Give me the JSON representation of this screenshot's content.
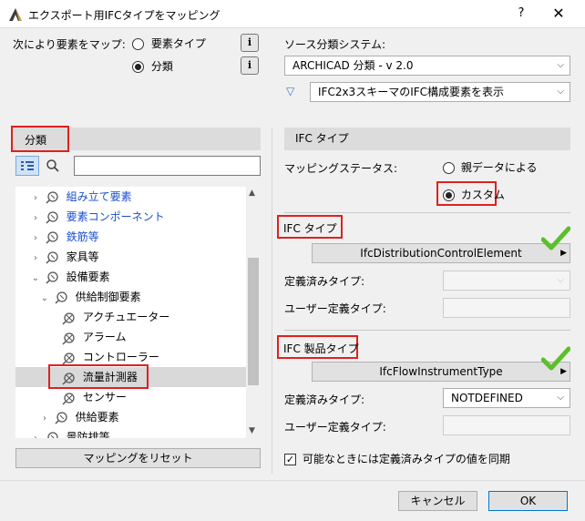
{
  "window": {
    "title": "エクスポート用IFCタイプをマッピング",
    "help": "?",
    "close": "✕"
  },
  "map_by": {
    "label": "次により要素をマップ:",
    "options": [
      {
        "label": "要素タイプ",
        "selected": false
      },
      {
        "label": "分類",
        "selected": true
      }
    ],
    "info_glyph": "i"
  },
  "source": {
    "label": "ソース分類システム:",
    "selected": "ARCHICAD 分類 - v 2.0",
    "filter_selected": "IFC2x3スキーマのIFC構成要素を表示"
  },
  "left": {
    "header": "分類",
    "search_placeholder": "",
    "tree": [
      {
        "label": "組み立て要素",
        "blue": true
      },
      {
        "label": "要素コンポーネント",
        "blue": true
      },
      {
        "label": "鉄筋等",
        "blue": true
      },
      {
        "label": "家具等",
        "blue": false
      },
      {
        "label": "設備要素",
        "blue": false
      },
      {
        "label": "供給制御要素",
        "blue": false
      },
      {
        "label": "アクチュエーター",
        "blue": false
      },
      {
        "label": "アラーム",
        "blue": false
      },
      {
        "label": "コントローラー",
        "blue": false
      },
      {
        "label": "流量計測器",
        "blue": false,
        "selected": true
      },
      {
        "label": "センサー",
        "blue": false
      },
      {
        "label": "供給要素",
        "blue": false
      },
      {
        "label": "景防排等",
        "blue": false
      }
    ],
    "reset_button": "マッピングをリセット"
  },
  "right": {
    "header": "IFC タイプ",
    "mapping_status_label": "マッピングステータス:",
    "status_options": [
      {
        "label": "親データによる",
        "selected": false
      },
      {
        "label": "カスタム",
        "selected": true
      }
    ],
    "ifc_type": {
      "label": "IFC タイプ",
      "value": "IfcDistributionControlElement",
      "predefined_label": "定義済みタイプ:",
      "predefined_value": "",
      "user_defined_label": "ユーザー定義タイプ:",
      "user_defined_value": ""
    },
    "ifc_product_type": {
      "label": "IFC 製品タイプ",
      "value": "IfcFlowInstrumentType",
      "predefined_label": "定義済みタイプ:",
      "predefined_value": "NOTDEFINED",
      "user_defined_label": "ユーザー定義タイプ:",
      "user_defined_value": ""
    },
    "sync_checkbox": {
      "label": "可能なときには定義済みタイプの値を同期",
      "checked": true
    }
  },
  "footer": {
    "cancel": "キャンセル",
    "ok": "OK"
  },
  "colors": {
    "highlight": "#e02020",
    "check": "#5bbf2a",
    "link": "#1a4fd1"
  }
}
